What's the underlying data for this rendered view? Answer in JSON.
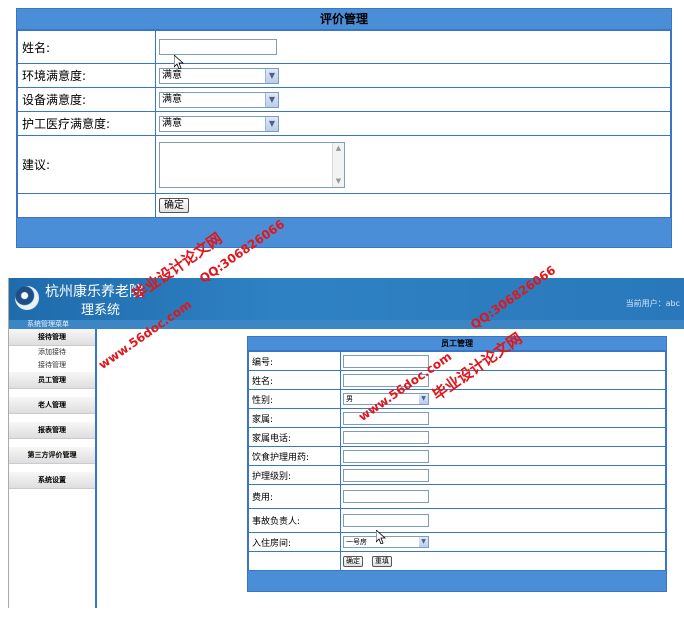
{
  "evaluation_form": {
    "title": "评价管理",
    "fields": [
      {
        "label": "姓名:",
        "type": "input",
        "value": ""
      },
      {
        "label": "环境满意度:",
        "type": "select",
        "value": "满意"
      },
      {
        "label": "设备满意度:",
        "type": "select",
        "value": "满意"
      },
      {
        "label": "护工医疗满意度:",
        "type": "select",
        "value": "满意"
      },
      {
        "label": "建议:",
        "type": "textarea",
        "value": ""
      }
    ],
    "submit_label": "确定"
  },
  "admin_system": {
    "title_line1": "杭州康乐养老院",
    "title_line2": "理系统",
    "current_user": "当前用户：abc",
    "subbar_text": "系统管理菜单",
    "sidebar": {
      "groups": [
        {
          "label": "接待管理",
          "items": [
            "添加接待",
            "接待管理"
          ]
        },
        {
          "label": "员工管理",
          "items": []
        },
        {
          "label": "老人管理",
          "items": []
        },
        {
          "label": "报表管理",
          "items": []
        },
        {
          "label": "第三方评价管理",
          "items": []
        },
        {
          "label": "系统设置",
          "items": []
        }
      ]
    },
    "employee_form": {
      "title": "员工管理",
      "fields": [
        {
          "label": "编号:",
          "type": "input",
          "value": ""
        },
        {
          "label": "姓名:",
          "type": "input",
          "value": ""
        },
        {
          "label": "性别:",
          "type": "select",
          "value": "男"
        },
        {
          "label": "家属:",
          "type": "input",
          "value": ""
        },
        {
          "label": "家属电话:",
          "type": "input",
          "value": ""
        },
        {
          "label": "饮食护理用药:",
          "type": "input",
          "value": ""
        },
        {
          "label": "护理级别:",
          "type": "input",
          "value": ""
        },
        {
          "label": "费用:",
          "type": "input",
          "value": ""
        },
        {
          "label": "事故负责人:",
          "type": "input",
          "value": ""
        },
        {
          "label": "入住房间:",
          "type": "select",
          "value": "一号房"
        }
      ],
      "confirm_label": "确定",
      "reset_label": "重填"
    }
  },
  "watermarks": {
    "site_cn": "毕业设计论文网",
    "site_url": "www.56doc.com",
    "qq": "QQ:306826066"
  },
  "colors": {
    "header_blue": "#4a8ed8",
    "border_blue": "#3a76c6",
    "watermark_red": "#e0161b"
  }
}
